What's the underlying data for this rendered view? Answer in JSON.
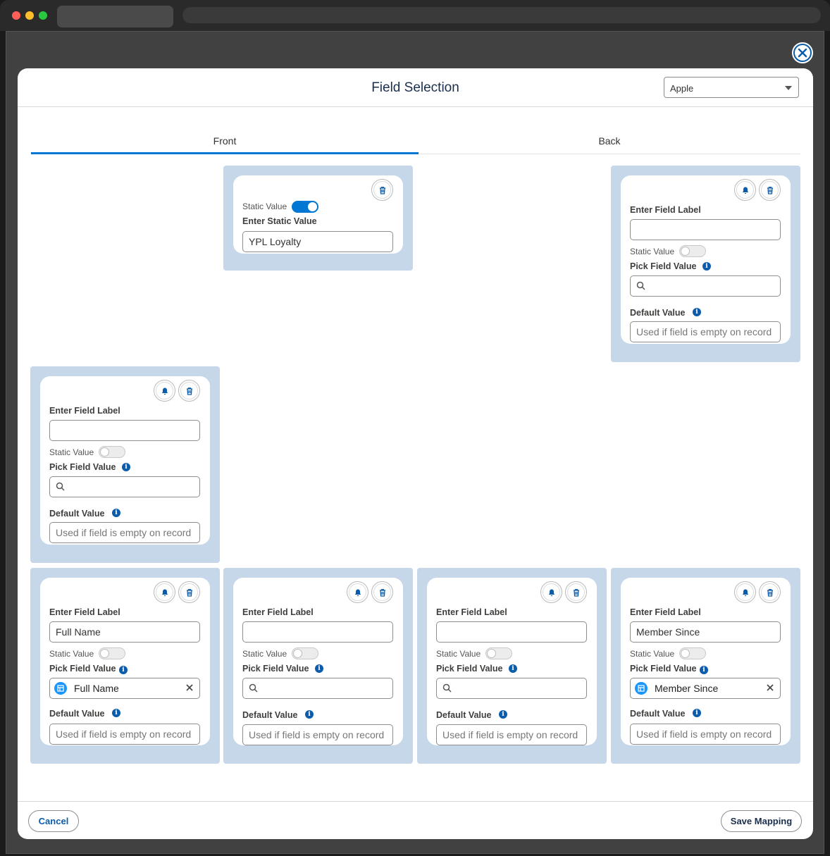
{
  "modal": {
    "title": "Field Selection",
    "combo_value": "Apple"
  },
  "tabs": {
    "front": "Front",
    "back": "Back"
  },
  "labels": {
    "static_value": "Static Value",
    "enter_static_value": "Enter Static Value",
    "enter_field_label": "Enter Field Label",
    "pick_field_value": "Pick Field Value",
    "default_value": "Default Value",
    "default_placeholder": "Used if field is empty on record"
  },
  "cards": {
    "static_card": {
      "static_on": true,
      "static_value": "YPL Loyalty"
    },
    "back_card": {
      "label_value": "",
      "picked": ""
    },
    "left_card": {
      "label_value": "",
      "picked": ""
    },
    "row_1": {
      "label_value": "Full Name",
      "picked": "Full Name"
    },
    "row_2": {
      "label_value": "",
      "picked": ""
    },
    "row_3": {
      "label_value": "",
      "picked": ""
    },
    "row_4": {
      "label_value": "Member Since",
      "picked": "Member Since"
    }
  },
  "footer": {
    "cancel_label": "Cancel",
    "save_label": "Save Mapping"
  },
  "icons": [
    "close-icon",
    "bell-icon",
    "trash-icon",
    "search-icon",
    "info-icon",
    "table-icon",
    "clear-icon",
    "chevron-down-icon"
  ],
  "colors": {
    "brand": "#0176d3",
    "slot": "#c6d7ea",
    "title": "#1a2f4d"
  }
}
